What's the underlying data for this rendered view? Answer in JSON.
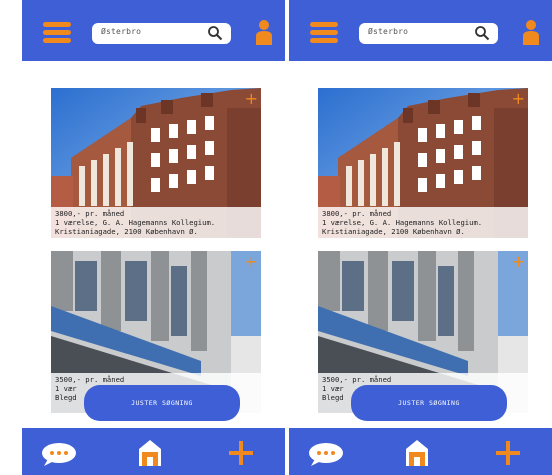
{
  "search": {
    "text": "Østerbro"
  },
  "listings": [
    {
      "line1": "3800,- pr. måned",
      "line2": "1 værelse, G. A. Hagemanns Kollegium.",
      "line3": "Kristianiagade, 2100 København Ø."
    },
    {
      "line1": "3500,- pr. måned",
      "line2": "1 vær",
      "line3": "Blegd"
    }
  ],
  "adjust_button": {
    "label": "JUSTER SØGNING"
  },
  "add_symbol": "+",
  "colors": {
    "bar": "#3e5fd6",
    "accent": "#f08a1f"
  },
  "icons": [
    "menu-icon",
    "search-icon",
    "person-icon",
    "chat-icon",
    "home-icon",
    "add-icon"
  ]
}
